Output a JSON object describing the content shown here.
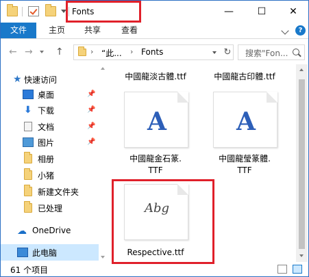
{
  "window": {
    "title": "Fonts",
    "controls": {
      "minimize": "—",
      "maximize": "☐",
      "close": "✕"
    }
  },
  "ribbon": {
    "tabs": [
      {
        "label": "文件"
      },
      {
        "label": "主页"
      },
      {
        "label": "共享"
      },
      {
        "label": "查看"
      }
    ],
    "help": "?"
  },
  "address": {
    "segments": [
      "“此...",
      "Fonts"
    ],
    "separator": "›",
    "refresh": "↻",
    "search_placeholder": "搜索\"Fon...",
    "back": "←",
    "forward": "→",
    "up": "↑"
  },
  "sidebar": {
    "items": [
      {
        "label": "快速访问",
        "icon": "star-icon"
      },
      {
        "label": "桌面",
        "icon": "desktop-icon",
        "pinned": true
      },
      {
        "label": "下载",
        "icon": "download-icon",
        "pinned": true
      },
      {
        "label": "文档",
        "icon": "document-icon",
        "pinned": true
      },
      {
        "label": "图片",
        "icon": "picture-icon",
        "pinned": true
      },
      {
        "label": "相册",
        "icon": "folder-icon"
      },
      {
        "label": "小猪",
        "icon": "folder-icon"
      },
      {
        "label": "新建文件夹",
        "icon": "folder-icon"
      },
      {
        "label": "已处理",
        "icon": "folder-icon"
      },
      {
        "label": "OneDrive",
        "icon": "onedrive-icon"
      },
      {
        "label": "此电脑",
        "icon": "computer-icon",
        "selected": true
      }
    ],
    "pin_glyph": "📌"
  },
  "files": [
    {
      "name": "中國龍淡古體.ttf",
      "type": "top-cut"
    },
    {
      "name": "中國龍古印體.ttf",
      "type": "top-cut"
    },
    {
      "name": "中國龍金石篆.",
      "name2": "TTF",
      "preview": "A",
      "type": "serif"
    },
    {
      "name": "中國龍瑩篆體.",
      "name2": "TTF",
      "preview": "A",
      "type": "serif"
    },
    {
      "name": "Respective.ttf",
      "preview": "Abg",
      "type": "script"
    }
  ],
  "status": {
    "count": "61 个项目"
  },
  "colors": {
    "accent": "#1979ca",
    "highlight_box": "#e0202a",
    "selected_bg": "#cce8ff"
  }
}
